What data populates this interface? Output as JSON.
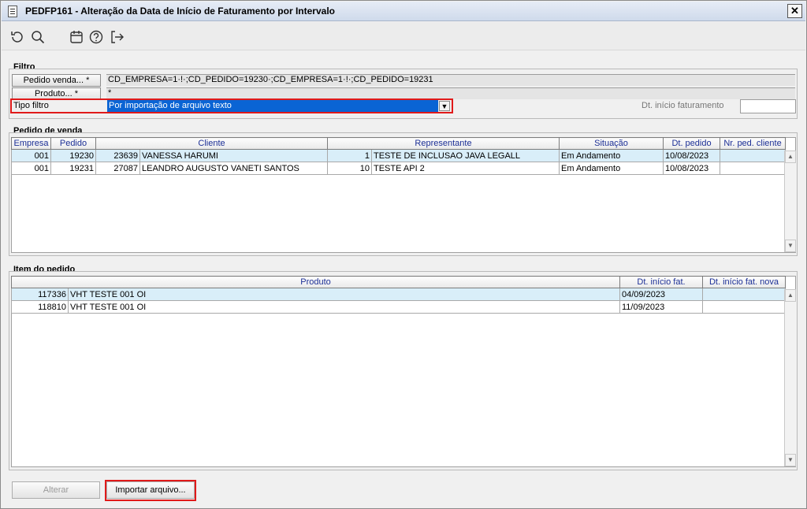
{
  "window": {
    "title": "PEDFP161 - Alteração da Data de Início de Faturamento por Intervalo",
    "close_label": "✕"
  },
  "toolbar": {
    "icons": [
      "refresh-icon",
      "search-icon",
      "calendar-icon",
      "help-icon",
      "exit-icon"
    ]
  },
  "filtro": {
    "group_label": "Filtro",
    "pedido_button": "Pedido venda... *",
    "pedido_value": "CD_EMPRESA=1·!·;CD_PEDIDO=19230·;CD_EMPRESA=1·!·;CD_PEDIDO=19231",
    "produto_button": "Produto... *",
    "produto_value": "*",
    "tipo_label": "Tipo filtro",
    "tipo_value": "Por importação de arquivo texto",
    "dt_label": "Dt. início faturamento",
    "dt_value": ""
  },
  "pedido_venda": {
    "group_label": "Pedido de venda",
    "columns": [
      "Empresa",
      "Pedido",
      "Cliente",
      "Representante",
      "Situação",
      "Dt. pedido",
      "Nr. ped. cliente"
    ],
    "rows": [
      {
        "empresa": "001",
        "pedido": "19230",
        "cliente_cod": "23639",
        "cliente": "VANESSA HARUMI",
        "rep_cod": "1",
        "representante": "TESTE DE INCLUSAO JAVA LEGALL",
        "situacao": "Em Andamento",
        "dt_pedido": "10/08/2023",
        "nr_ped_cliente": ""
      },
      {
        "empresa": "001",
        "pedido": "19231",
        "cliente_cod": "27087",
        "cliente": "LEANDRO AUGUSTO VANETI SANTOS",
        "rep_cod": "10",
        "representante": "TESTE API 2",
        "situacao": "Em Andamento",
        "dt_pedido": "10/08/2023",
        "nr_ped_cliente": ""
      }
    ]
  },
  "item_pedido": {
    "group_label": "Item do pedido",
    "columns": [
      "Produto",
      "Dt. início fat.",
      "Dt. início fat. nova"
    ],
    "rows": [
      {
        "prod_cod": "117336",
        "produto": "VHT TESTE 001 OI",
        "dt_inicio": "04/09/2023",
        "dt_nova": ""
      },
      {
        "prod_cod": "118810",
        "produto": "VHT TESTE 001 OI",
        "dt_inicio": "11/09/2023",
        "dt_nova": ""
      }
    ]
  },
  "actions": {
    "alterar": "Alterar",
    "importar": "Importar arquivo..."
  },
  "colors": {
    "selection": "#0a64d4",
    "highlight_border": "#e01a1a",
    "row_selected": "#d9eef9",
    "header_text": "#1c2f96"
  }
}
